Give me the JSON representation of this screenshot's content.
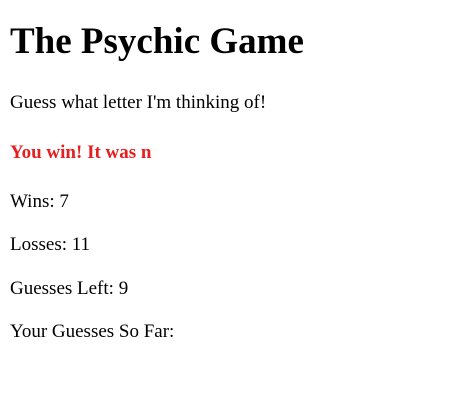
{
  "game": {
    "title": "The Psychic Game",
    "prompt": "Guess what letter I'm thinking of!",
    "result_message": "You win! It was n",
    "result_color": "#e61e1e",
    "wins_text": "Wins: 7",
    "losses_text": "Losses: 11",
    "guesses_left_text": "Guesses Left: 9",
    "guesses_so_far_text": "Your Guesses So Far:"
  }
}
